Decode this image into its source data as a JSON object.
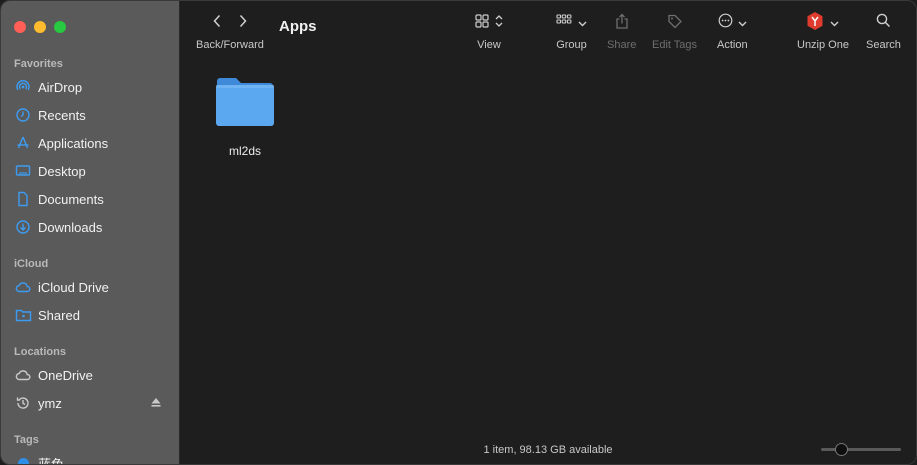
{
  "sidebar": {
    "favorites_label": "Favorites",
    "favorites": [
      {
        "label": "AirDrop",
        "icon": "airdrop-icon"
      },
      {
        "label": "Recents",
        "icon": "clock-icon"
      },
      {
        "label": "Applications",
        "icon": "applications-icon"
      },
      {
        "label": "Desktop",
        "icon": "desktop-icon"
      },
      {
        "label": "Documents",
        "icon": "document-icon"
      },
      {
        "label": "Downloads",
        "icon": "download-icon"
      }
    ],
    "icloud_label": "iCloud",
    "icloud": [
      {
        "label": "iCloud Drive",
        "icon": "cloud-icon"
      },
      {
        "label": "Shared",
        "icon": "shared-folder-icon"
      }
    ],
    "locations_label": "Locations",
    "locations": [
      {
        "label": "OneDrive",
        "icon": "cloud-outline-icon"
      },
      {
        "label": "ymz",
        "icon": "time-machine-icon"
      }
    ],
    "tags_label": "Tags",
    "tags": [
      {
        "label": "蓝色",
        "color": "#2f8fe8"
      }
    ]
  },
  "toolbar": {
    "back_forward_label": "Back/Forward",
    "title": "Apps",
    "view_label": "View",
    "group_label": "Group",
    "share_label": "Share",
    "edit_tags_label": "Edit Tags",
    "action_label": "Action",
    "unzip_label": "Unzip One",
    "search_label": "Search"
  },
  "content": {
    "items": [
      {
        "name": "ml2ds",
        "kind": "folder"
      }
    ]
  },
  "status_bar": {
    "text": "1 item, 98.13 GB available"
  },
  "colors": {
    "accent": "#2f8fe8",
    "folder": "#5ba8f0",
    "sidebar_bg": "#5a5a5a",
    "main_bg": "#1e1e1e"
  }
}
